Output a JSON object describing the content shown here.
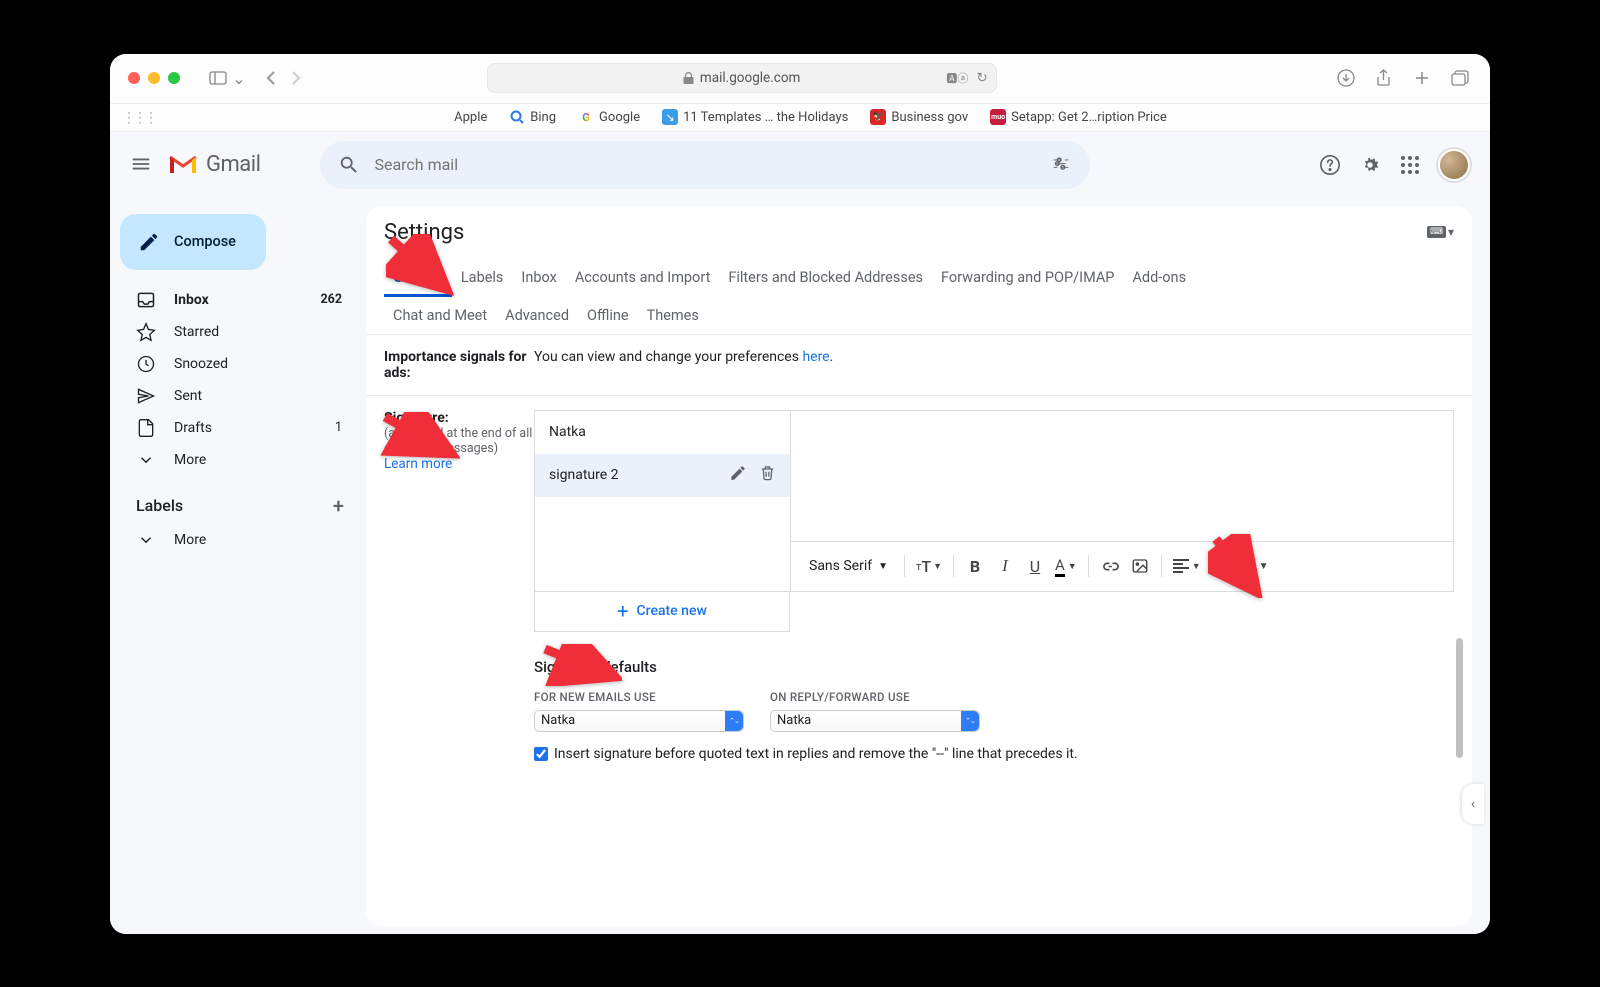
{
  "browser": {
    "url_host": "mail.google.com",
    "bookmarks": [
      {
        "icon": "apple",
        "label": "Apple"
      },
      {
        "icon": "bing",
        "label": "Bing"
      },
      {
        "icon": "google",
        "label": "Google"
      },
      {
        "icon": "tpl",
        "label": "11 Templates … the Holidays"
      },
      {
        "icon": "biz",
        "label": "Business gov"
      },
      {
        "icon": "setapp",
        "label": "Setapp: Get 2…ription Price"
      }
    ]
  },
  "gmail": {
    "product": "Gmail",
    "search_placeholder": "Search mail",
    "compose": "Compose",
    "nav": {
      "inbox": {
        "label": "Inbox",
        "count": "262"
      },
      "starred": "Starred",
      "snoozed": "Snoozed",
      "sent": "Sent",
      "drafts": {
        "label": "Drafts",
        "count": "1"
      },
      "more": "More"
    },
    "labels_header": "Labels",
    "labels_more": "More"
  },
  "settings": {
    "title": "Settings",
    "tabs": [
      "General",
      "Labels",
      "Inbox",
      "Accounts and Import",
      "Filters and Blocked Addresses",
      "Forwarding and POP/IMAP",
      "Add-ons",
      "Chat and Meet",
      "Advanced",
      "Offline",
      "Themes"
    ],
    "importance": {
      "label": "Importance signals for ads:",
      "text_pre": "You can view and change your preferences ",
      "link": "here",
      "text_post": "."
    },
    "signature": {
      "label": "Signature:",
      "sub": "(appended at the end of all outgoing messages)",
      "learn": "Learn more",
      "items": [
        "Natka",
        "signature 2"
      ],
      "selected_index": 1,
      "font": "Sans Serif",
      "create": "Create new",
      "defaults_title": "Signature defaults",
      "new_label": "FOR NEW EMAILS USE",
      "reply_label": "ON REPLY/FORWARD USE",
      "new_value": "Natka",
      "reply_value": "Natka",
      "checkbox_text": "Insert signature before quoted text in replies and remove the \"--\" line that precedes it."
    }
  }
}
